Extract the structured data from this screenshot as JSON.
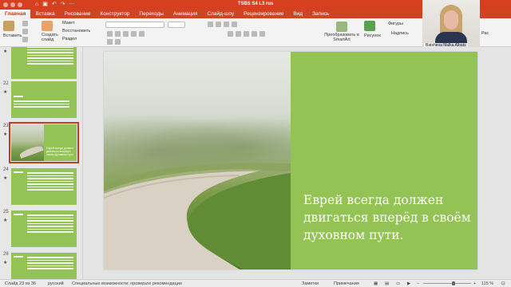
{
  "window": {
    "title": "TSBS S4 L3 rus"
  },
  "tabs": [
    {
      "label": "Главная",
      "active": true
    },
    {
      "label": "Вставка"
    },
    {
      "label": "Рисование"
    },
    {
      "label": "Конструктор"
    },
    {
      "label": "Переходы"
    },
    {
      "label": "Анимация"
    },
    {
      "label": "Слайд-шоу"
    },
    {
      "label": "Рецензирование"
    },
    {
      "label": "Вид"
    },
    {
      "label": "Запись"
    }
  ],
  "ribbon": {
    "paste_label": "Вставить",
    "new_slide_label": "Создать слайд",
    "layout_label": "Макет",
    "reset_label": "Восстановить",
    "section_label": "Раздел",
    "convert_label": "Преобразовать в SmartArt",
    "picture_label": "Рисунок",
    "shapes_label": "Фигуры",
    "textbox_label": "Надпись",
    "arrange_label": "Рас"
  },
  "webcam": {
    "name": "Batsheva Malka Albats"
  },
  "slides": [
    {
      "number": "",
      "top": 0
    },
    {
      "number": "22"
    },
    {
      "number": "23",
      "selected": true,
      "text": "Еврей всегда должен двигаться вперёд в своём духовном пути."
    },
    {
      "number": "24"
    },
    {
      "number": "25"
    },
    {
      "number": "26"
    }
  ],
  "slide": {
    "text": "Еврей всегда должен двигаться вперёд в своём духовном пути."
  },
  "status": {
    "slide_counter": "Слайд 23 из 36",
    "language": "русский",
    "accessibility": "Специальные возможности: проверьте рекомендации",
    "notes": "Заметки",
    "comments": "Примечания",
    "zoom": "115 %"
  },
  "colors": {
    "accent": "#d04423",
    "slide_green": "#93c355"
  }
}
